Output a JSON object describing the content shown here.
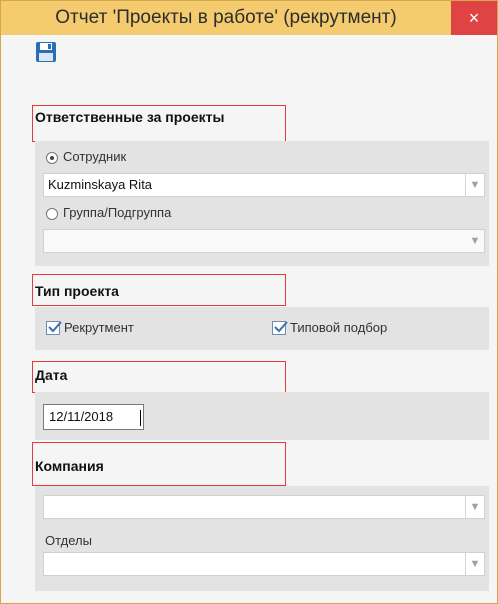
{
  "window": {
    "title": "Отчет 'Проекты в работе' (рекрутмент)",
    "close_glyph": "×"
  },
  "toolbar": {
    "save_icon": "save-icon"
  },
  "responsible": {
    "label": "Ответственные за проекты",
    "employee_label": "Сотрудник",
    "employee_selected": true,
    "employee_value": "Kuzminskaya Rita",
    "group_label": "Группа/Подгруппа",
    "group_value": ""
  },
  "project_type": {
    "label": "Тип проекта",
    "recruitment_label": "Рекрутмент",
    "recruitment_checked": true,
    "typical_label": "Типовой подбор",
    "typical_checked": true
  },
  "date": {
    "label": "Дата",
    "value": "12/11/2018"
  },
  "company": {
    "label": "Компания",
    "company_value": "",
    "departments_label": "Отделы",
    "departments_value": ""
  },
  "colors": {
    "titlebar": "#f4cc6f",
    "close": "#e04343",
    "highlight": "#e53b3b",
    "panel": "#e3e3e3"
  }
}
